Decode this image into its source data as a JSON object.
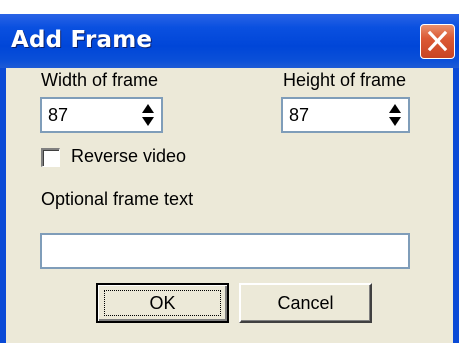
{
  "window": {
    "title": "Add Frame",
    "close_icon": "close-x-icon"
  },
  "width_field": {
    "label": "Width of frame",
    "value": "87"
  },
  "height_field": {
    "label": "Height of frame",
    "value": "87"
  },
  "reverse_video": {
    "label": "Reverse video",
    "checked": false
  },
  "frame_text": {
    "label": "Optional frame text",
    "value": ""
  },
  "buttons": {
    "ok_label": "OK",
    "cancel_label": "Cancel"
  },
  "colors": {
    "titlebar": "#0046d8",
    "close_button": "#dc5a34",
    "dialog_bg": "#ece9d8",
    "field_border": "#7f9db9"
  }
}
